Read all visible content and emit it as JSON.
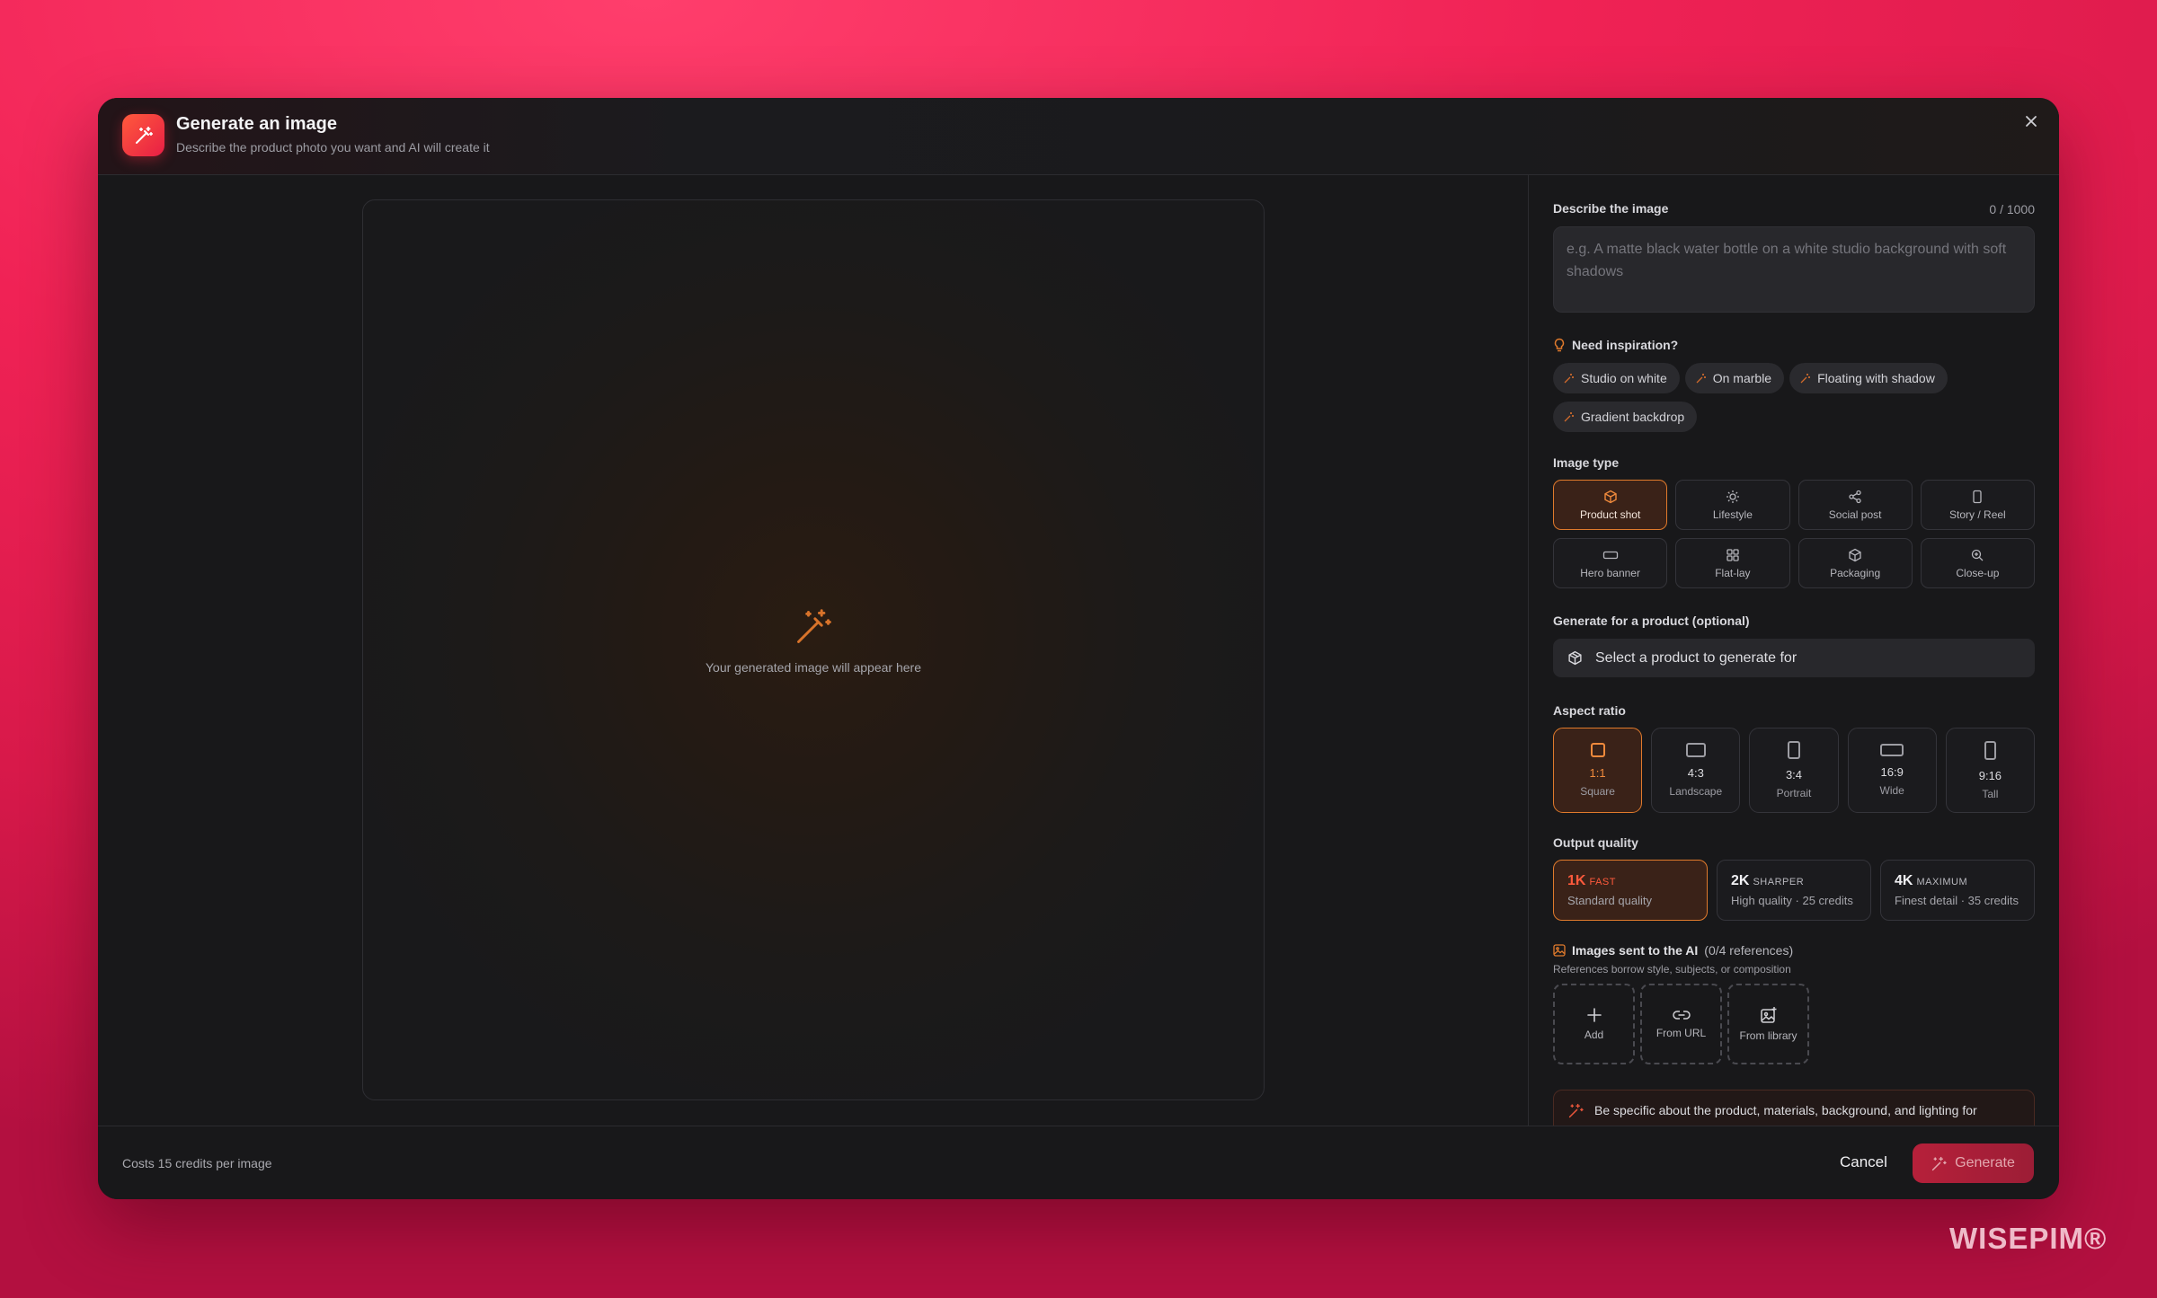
{
  "dialog": {
    "title": "Generate an image",
    "subtitle": "Describe the product photo you want and AI will create it"
  },
  "preview": {
    "placeholder": "Your generated image will appear here"
  },
  "describe": {
    "label": "Describe the image",
    "counter": "0 / 1000",
    "placeholder": "e.g. A matte black water bottle on a white studio background with soft shadows"
  },
  "inspiration": {
    "label": "Need inspiration?",
    "chips": [
      "Studio on white",
      "On marble",
      "Floating with shadow",
      "Gradient backdrop"
    ]
  },
  "image_type": {
    "label": "Image type",
    "options": [
      {
        "label": "Product shot",
        "icon": "cube-icon",
        "selected": true
      },
      {
        "label": "Lifestyle",
        "icon": "sun-icon",
        "selected": false
      },
      {
        "label": "Social post",
        "icon": "share-icon",
        "selected": false
      },
      {
        "label": "Story / Reel",
        "icon": "phone-icon",
        "selected": false
      },
      {
        "label": "Hero banner",
        "icon": "banner-icon",
        "selected": false
      },
      {
        "label": "Flat-lay",
        "icon": "grid-icon",
        "selected": false
      },
      {
        "label": "Packaging",
        "icon": "box-icon",
        "selected": false
      },
      {
        "label": "Close-up",
        "icon": "zoom-icon",
        "selected": false
      }
    ]
  },
  "product": {
    "label": "Generate for a product (optional)",
    "placeholder": "Select a product to generate for"
  },
  "aspect_ratio": {
    "label": "Aspect ratio",
    "options": [
      {
        "value": "1:1",
        "label": "Square",
        "selected": true
      },
      {
        "value": "4:3",
        "label": "Landscape",
        "selected": false
      },
      {
        "value": "3:4",
        "label": "Portrait",
        "selected": false
      },
      {
        "value": "16:9",
        "label": "Wide",
        "selected": false
      },
      {
        "value": "9:16",
        "label": "Tall",
        "selected": false
      }
    ]
  },
  "quality": {
    "label": "Output quality",
    "options": [
      {
        "res": "1K",
        "tag": "FAST",
        "desc": "Standard quality",
        "selected": true
      },
      {
        "res": "2K",
        "tag": "SHARPER",
        "desc": "High quality · 25 credits",
        "selected": false
      },
      {
        "res": "4K",
        "tag": "MAXIMUM",
        "desc": "Finest detail · 35 credits",
        "selected": false
      }
    ]
  },
  "references": {
    "label": "Images sent to the AI",
    "count": "(0/4 references)",
    "hint": "References borrow style, subjects, or composition",
    "actions": [
      "Add",
      "From URL",
      "From library"
    ]
  },
  "tip": {
    "text": "Be specific about the product, materials, background, and lighting for"
  },
  "footer": {
    "credits": "Costs 15 credits per image",
    "cancel": "Cancel",
    "generate": "Generate"
  },
  "brand": "WISEPIM®",
  "colors": {
    "accent": "#e07a2c",
    "brand_red": "#e81e45",
    "background": "#f02255",
    "panel": "#18181a"
  }
}
